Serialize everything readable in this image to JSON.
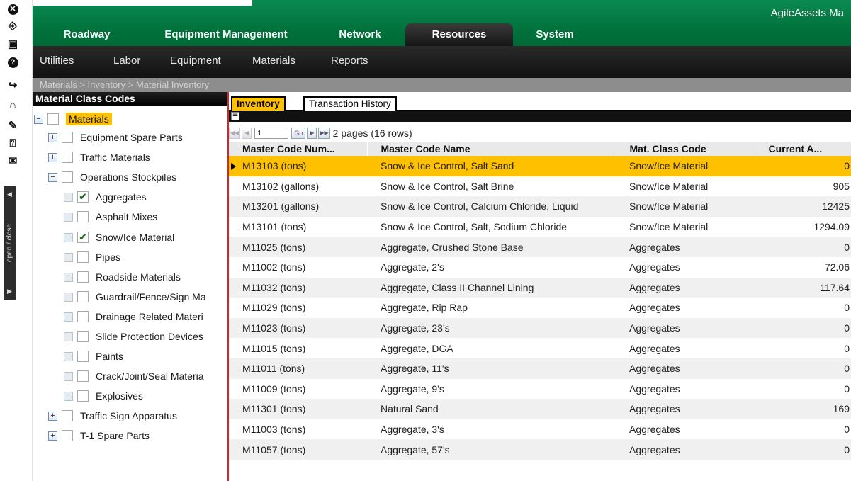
{
  "app": {
    "brand": "AgileAssets Ma"
  },
  "topnav": {
    "tabs": [
      {
        "label": "Roadway"
      },
      {
        "label": "Equipment Management"
      },
      {
        "label": "Network"
      },
      {
        "label": "Resources"
      },
      {
        "label": "System"
      }
    ],
    "active_tab": "Resources"
  },
  "subnav": {
    "items": [
      {
        "label": "Utilities"
      },
      {
        "label": "Labor"
      },
      {
        "label": "Equipment"
      },
      {
        "label": "Materials"
      },
      {
        "label": "Reports"
      }
    ]
  },
  "breadcrumb": "Materials > Inventory > Material Inventory",
  "left_toolbar": {
    "icons": [
      "close-icon",
      "exit-icon",
      "save-icon",
      "help-icon",
      "login-icon",
      "home-icon",
      "edit-icon",
      "help-context-icon",
      "mail-icon"
    ],
    "toggle_label": "open / close"
  },
  "tree": {
    "header": "Material Class Codes",
    "root": "Materials",
    "nodes": [
      {
        "label": "Equipment Spare Parts",
        "level": 1,
        "expander": "+",
        "checked": false
      },
      {
        "label": "Traffic Materials",
        "level": 1,
        "expander": "+",
        "checked": false
      },
      {
        "label": "Operations Stockpiles",
        "level": 1,
        "expander": "−",
        "checked": false
      },
      {
        "label": "Aggregates",
        "level": 2,
        "checked": true
      },
      {
        "label": "Asphalt Mixes",
        "level": 2,
        "checked": false
      },
      {
        "label": "Snow/Ice Material",
        "level": 2,
        "checked": true
      },
      {
        "label": "Pipes",
        "level": 2,
        "checked": false
      },
      {
        "label": "Roadside Materials",
        "level": 2,
        "checked": false
      },
      {
        "label": "Guardrail/Fence/Sign Ma",
        "level": 2,
        "checked": false
      },
      {
        "label": "Drainage Related Materi",
        "level": 2,
        "checked": false
      },
      {
        "label": "Slide Protection Devices",
        "level": 2,
        "checked": false
      },
      {
        "label": "Paints",
        "level": 2,
        "checked": false
      },
      {
        "label": "Crack/Joint/Seal Materia",
        "level": 2,
        "checked": false
      },
      {
        "label": "Explosives",
        "level": 2,
        "checked": false
      },
      {
        "label": "Traffic Sign Apparatus",
        "level": 1,
        "expander": "+",
        "checked": false
      },
      {
        "label": "T-1 Spare Parts",
        "level": 1,
        "expander": "+",
        "checked": false
      }
    ]
  },
  "tabs": [
    {
      "label": "Inventory"
    },
    {
      "label": "Transaction History"
    }
  ],
  "pager": {
    "page_input": "1",
    "go_label": "Go",
    "text": "2 pages (16 rows)"
  },
  "grid": {
    "columns": [
      "Master Code Num...",
      "Master Code Name",
      "Mat. Class Code",
      "Current A..."
    ],
    "rows": [
      [
        "M13103 (tons)",
        "Snow & Ice Control, Salt Sand",
        "Snow/Ice Material",
        "0"
      ],
      [
        "M13102 (gallons)",
        "Snow & Ice Control, Salt Brine",
        "Snow/Ice Material",
        "905"
      ],
      [
        "M13201 (gallons)",
        "Snow & Ice Control, Calcium Chloride, Liquid",
        "Snow/Ice Material",
        "12425"
      ],
      [
        "M13101 (tons)",
        "Snow & Ice Control, Salt, Sodium Chloride",
        "Snow/Ice Material",
        "1294.09"
      ],
      [
        "M11025 (tons)",
        "Aggregate, Crushed Stone Base",
        "Aggregates",
        "0"
      ],
      [
        "M11002 (tons)",
        "Aggregate, 2's",
        "Aggregates",
        "72.06"
      ],
      [
        "M11032 (tons)",
        "Aggregate, Class II Channel Lining",
        "Aggregates",
        "117.64"
      ],
      [
        "M11029 (tons)",
        "Aggregate, Rip Rap",
        "Aggregates",
        "0"
      ],
      [
        "M11023 (tons)",
        "Aggregate, 23's",
        "Aggregates",
        "0"
      ],
      [
        "M11015 (tons)",
        "Aggregate, DGA",
        "Aggregates",
        "0"
      ],
      [
        "M11011 (tons)",
        "Aggregate, 11's",
        "Aggregates",
        "0"
      ],
      [
        "M11009 (tons)",
        "Aggregate, 9's",
        "Aggregates",
        "0"
      ],
      [
        "M11301 (tons)",
        "Natural Sand",
        "Aggregates",
        "169"
      ],
      [
        "M11003 (tons)",
        "Aggregate, 3's",
        "Aggregates",
        "0"
      ],
      [
        "M11057 (tons)",
        "Aggregate, 57's",
        "Aggregates",
        "0"
      ]
    ],
    "selected_row": 0
  },
  "colors": {
    "brand_green": "#00703a",
    "accent_yellow": "#ffc000",
    "splitter_red": "#dd2222"
  }
}
